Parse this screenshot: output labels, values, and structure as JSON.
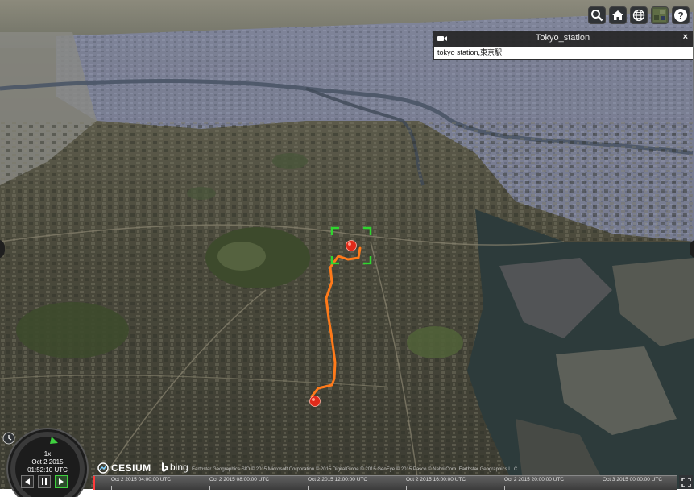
{
  "toolbar": {
    "buttons": [
      {
        "name": "geocoder-search-button",
        "icon": "search-icon"
      },
      {
        "name": "home-button",
        "icon": "home-icon"
      },
      {
        "name": "scene-mode-button",
        "icon": "globe-icon"
      },
      {
        "name": "base-layer-picker-button",
        "icon": "imagery-icon"
      },
      {
        "name": "help-button",
        "icon": "help-icon"
      }
    ]
  },
  "infobox": {
    "title": "Tokyo_station",
    "close_label": "×",
    "description": "tokyo station,東京駅"
  },
  "animation": {
    "speed": "1x",
    "date": "Oct 2 2015",
    "time": "01:52:10 UTC"
  },
  "logos": {
    "cesium": "CESIUM",
    "bing": "bing"
  },
  "credits": "Earthstar Geographics SIO © 2015 Microsoft Corporation   © 2015 DigitalGlobe © 2015 GeoEye © 2015 Pasco © Nahri Corp. Earthstar Geographics LLC",
  "timeline": {
    "labels": [
      "Oct 2 2015 04:00:00 UTC",
      "Oct 2 2015 08:00:00 UTC",
      "Oct 2 2015 12:00:00 UTC",
      "Oct 2 2015 16:00:00 UTC",
      "Oct 2 2015 20:00:00 UTC",
      "Oct 3 2015 00:00:00 UTC"
    ]
  },
  "colors": {
    "route": "#ff7a1a",
    "marker": "#e02a1a",
    "selection": "#2fd62f",
    "ui_dark": "#303336"
  }
}
